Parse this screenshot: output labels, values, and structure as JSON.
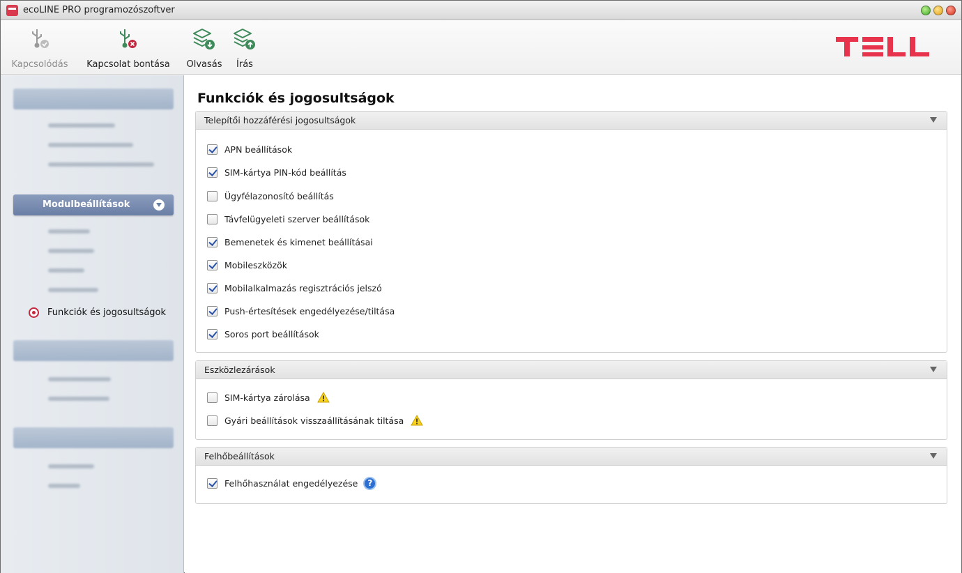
{
  "window": {
    "title": "ecoLINE PRO programozószoftver"
  },
  "toolbar": {
    "connect_label": "Kapcsolódás",
    "disconnect_label": "Kapcsolat bontása",
    "read_label": "Olvasás",
    "write_label": "Írás"
  },
  "logo": {
    "text": "TELL",
    "color": "#e8334c"
  },
  "sidebar": {
    "group_active_label": "Modulbeállítások",
    "selected_item_label": "Funkciók és jogosultságok"
  },
  "main": {
    "page_title": "Funkciók és jogosultságok",
    "sections": [
      {
        "title": "Telepítői hozzáférési jogosultságok",
        "items": [
          {
            "label": "APN beállítások",
            "checked": true
          },
          {
            "label": "SIM-kártya PIN-kód beállítás",
            "checked": true
          },
          {
            "label": "Ügyfélazonosító beállítás",
            "checked": false
          },
          {
            "label": "Távfelügyeleti szerver beállítások",
            "checked": false
          },
          {
            "label": "Bemenetek és kimenet beállításai",
            "checked": true
          },
          {
            "label": "Mobileszközök",
            "checked": true
          },
          {
            "label": "Mobilalkalmazás regisztrációs jelszó",
            "checked": true
          },
          {
            "label": "Push-értesítések engedélyezése/tiltása",
            "checked": true
          },
          {
            "label": "Soros port beállítások",
            "checked": true
          }
        ]
      },
      {
        "title": "Eszközlezárások",
        "items": [
          {
            "label": "SIM-kártya zárolása",
            "checked": false,
            "icon": "warning-icon"
          },
          {
            "label": "Gyári beállítások visszaállításának tiltása",
            "checked": false,
            "icon": "warning-icon"
          }
        ]
      },
      {
        "title": "Felhőbeállítások",
        "items": [
          {
            "label": "Felhőhasználat engedélyezése",
            "checked": true,
            "icon": "help-icon",
            "icon_text": "?"
          }
        ]
      }
    ]
  },
  "colors": {
    "accent_red": "#c2283f",
    "checkmark_blue": "#2a54a8",
    "toolbar_icon_green": "#3f8a5a",
    "sidebar_header": "#7388ad"
  }
}
